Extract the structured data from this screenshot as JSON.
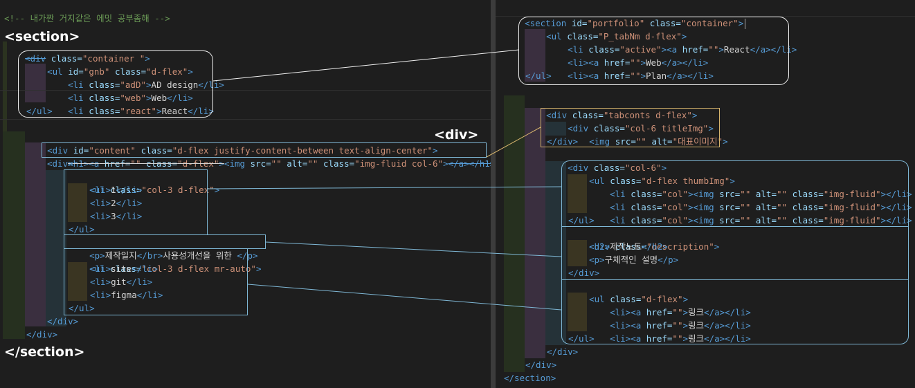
{
  "left": {
    "comment": "<!-- 내가짠 거지같은 에밋 공부좀해 -->",
    "labels": {
      "section_open": "<section>",
      "div": "<div>",
      "section_close": "</section>"
    },
    "lines": {
      "div_container": [
        "<div",
        " class=",
        "\"container \"",
        ">"
      ],
      "ul_gnb": [
        "<ul",
        " id=",
        "\"gnb\"",
        " class=",
        "\"d-flex\"",
        ">"
      ],
      "li_ad": [
        "<li",
        " class=",
        "\"adD\"",
        ">",
        "AD design",
        "</li>"
      ],
      "li_web": [
        "<li",
        " class=",
        "\"web\"",
        ">",
        "Web",
        "</li>"
      ],
      "li_react": [
        "<li",
        " class=",
        "\"react\"",
        ">",
        "React",
        "</li>"
      ],
      "ul_close": "</ul>",
      "div_content": [
        "<div",
        " id=",
        "\"content\"",
        " class=",
        "\"d-flex justify-content-between text-align-center\"",
        ">"
      ],
      "h1_line": [
        "<h1><a",
        " href=",
        "\"\"",
        " class=",
        "\"d-flex\"",
        ">",
        "<img",
        " src=",
        "\"\"",
        " alt=",
        "\"\"",
        " class=",
        "\"img-fluid col-6\"",
        ">",
        "</a></h1>"
      ],
      "div_open": "<div>",
      "ul_col3": [
        "<ul",
        " class=",
        "\"col-3 d-flex\"",
        ">"
      ],
      "li_1": [
        "<li>",
        "1",
        "</li>"
      ],
      "li_2": [
        "<li>",
        "2",
        "</li>"
      ],
      "li_3": [
        "<li>",
        "3",
        "</li>"
      ],
      "ul_close2": "</ul>",
      "p_line": [
        "<p>",
        "제작일지",
        "</br>",
        "사용성개선을 위한 ",
        "</p>"
      ],
      "ul_col3b": [
        "<ul",
        " class=",
        "\"col-3 d-flex mr-auto\"",
        ">"
      ],
      "li_site": [
        "<li>",
        "site",
        "</li>"
      ],
      "li_git": [
        "<li>",
        "git",
        "</li>"
      ],
      "li_figma": [
        "<li>",
        "figma",
        "</li>"
      ],
      "ul_close3": "</ul>",
      "div_close1": "</div>",
      "div_close2": "</div>"
    }
  },
  "right": {
    "lines": {
      "section": [
        "<section",
        " id=",
        "\"portfolio\"",
        " class=",
        "\"container\"",
        ">"
      ],
      "ul_tab": [
        "<ul",
        " class=",
        "\"P_tabNm d-flex\"",
        ">"
      ],
      "li_active": [
        "<li",
        " class=",
        "\"active\"",
        "><a",
        " href=",
        "\"\"",
        ">",
        "React",
        "</a></li>"
      ],
      "li_web": [
        "<li><a",
        " href=",
        "\"\"",
        ">",
        "Web",
        "</a></li>"
      ],
      "li_plan": [
        "<li><a",
        " href=",
        "\"\"",
        ">",
        "Plan",
        "</a></li>"
      ],
      "ul_close": "</ul>",
      "div_tabconts": [
        "<div",
        " class=",
        "\"tabconts d-flex\"",
        ">"
      ],
      "div_title": [
        "<div",
        " class=",
        "\"col-6 titleImg\"",
        ">"
      ],
      "img_title": [
        "<img",
        " src=",
        "\"\"",
        " alt=",
        "\"대표이미지\"",
        ">"
      ],
      "div_close_a": "</div>",
      "div_col6": [
        "<div",
        " class=",
        "\"col-6\"",
        ">"
      ],
      "ul_thumb": [
        "<ul",
        " class=",
        "\"d-flex thumbImg\"",
        ">"
      ],
      "li_col_1": [
        "<li",
        " class=",
        "\"col\"",
        "><img",
        " src=",
        "\"\"",
        " alt=",
        "\"\"",
        " class=",
        "\"img-fluid\"",
        "></li>"
      ],
      "li_col_2": [
        "<li",
        " class=",
        "\"col\"",
        "><img",
        " src=",
        "\"\"",
        " alt=",
        "\"\"",
        " class=",
        "\"img-fluid\"",
        "></li>"
      ],
      "li_col_3": [
        "<li",
        " class=",
        "\"col\"",
        "><img",
        " src=",
        "\"\"",
        " alt=",
        "\"\"",
        " class=",
        "\"img-fluid\"",
        "></li>"
      ],
      "ul_close_b": "</ul>",
      "div_desc": [
        "<div",
        " class=",
        "\"description\"",
        ">"
      ],
      "h2": [
        "<h2>",
        "제작노트",
        "</h2>"
      ],
      "p": [
        "<p>",
        "구체적인 설명",
        "</p>"
      ],
      "div_close_b": "</div>",
      "ul_flex": [
        "<ul",
        " class=",
        "\"d-flex\"",
        ">"
      ],
      "li_link_1": [
        "<li><a",
        " href=",
        "\"\"",
        ">",
        "링크",
        "</a></li>"
      ],
      "li_link_2": [
        "<li><a",
        " href=",
        "\"\"",
        ">",
        "링크",
        "</a></li>"
      ],
      "li_link_3": [
        "<li><a",
        " href=",
        "\"\"",
        ">",
        "링크",
        "</a></li>"
      ],
      "ul_close_c": "</ul>",
      "div_close_c": "</div>",
      "div_close_d": "</div>",
      "div_close_e": "</div>",
      "section_close": "</section>"
    }
  },
  "colors": {
    "tag": "#569cd6",
    "attr": "#9cdcfe",
    "string": "#ce9178",
    "text": "#d4d4d4",
    "comment": "#6a9955",
    "background": "#1e1e1e"
  }
}
